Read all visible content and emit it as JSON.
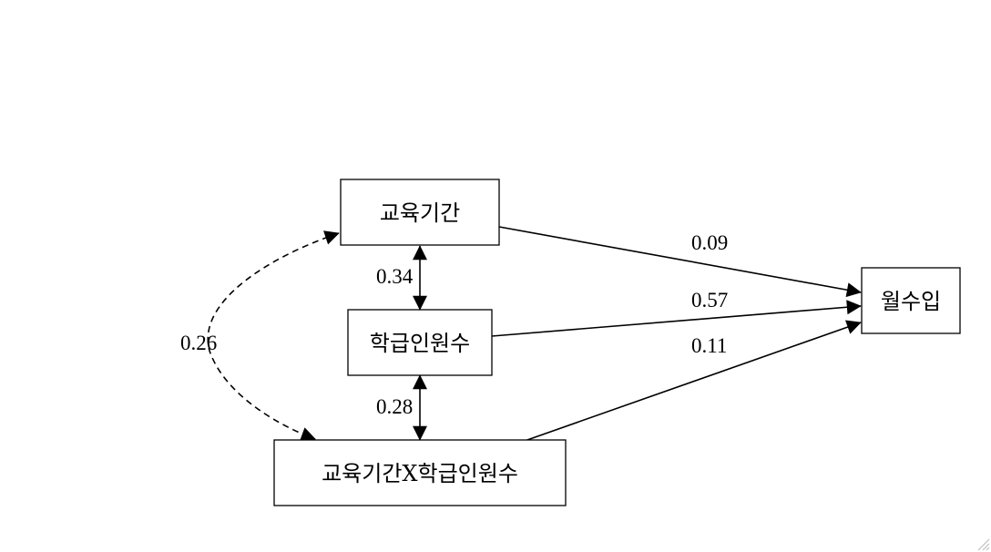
{
  "diagram": {
    "nodes": {
      "education_period": "교육기간",
      "class_size": "학급인원수",
      "interaction": "교육기간X학급인원수",
      "monthly_income": "월수입"
    },
    "edges": {
      "education_to_income": "0.09",
      "classsize_to_income": "0.57",
      "interaction_to_income": "0.11",
      "education_classsize_cov": "0.34",
      "classsize_interaction_cov": "0.28",
      "education_interaction_cov": "0.26"
    }
  }
}
